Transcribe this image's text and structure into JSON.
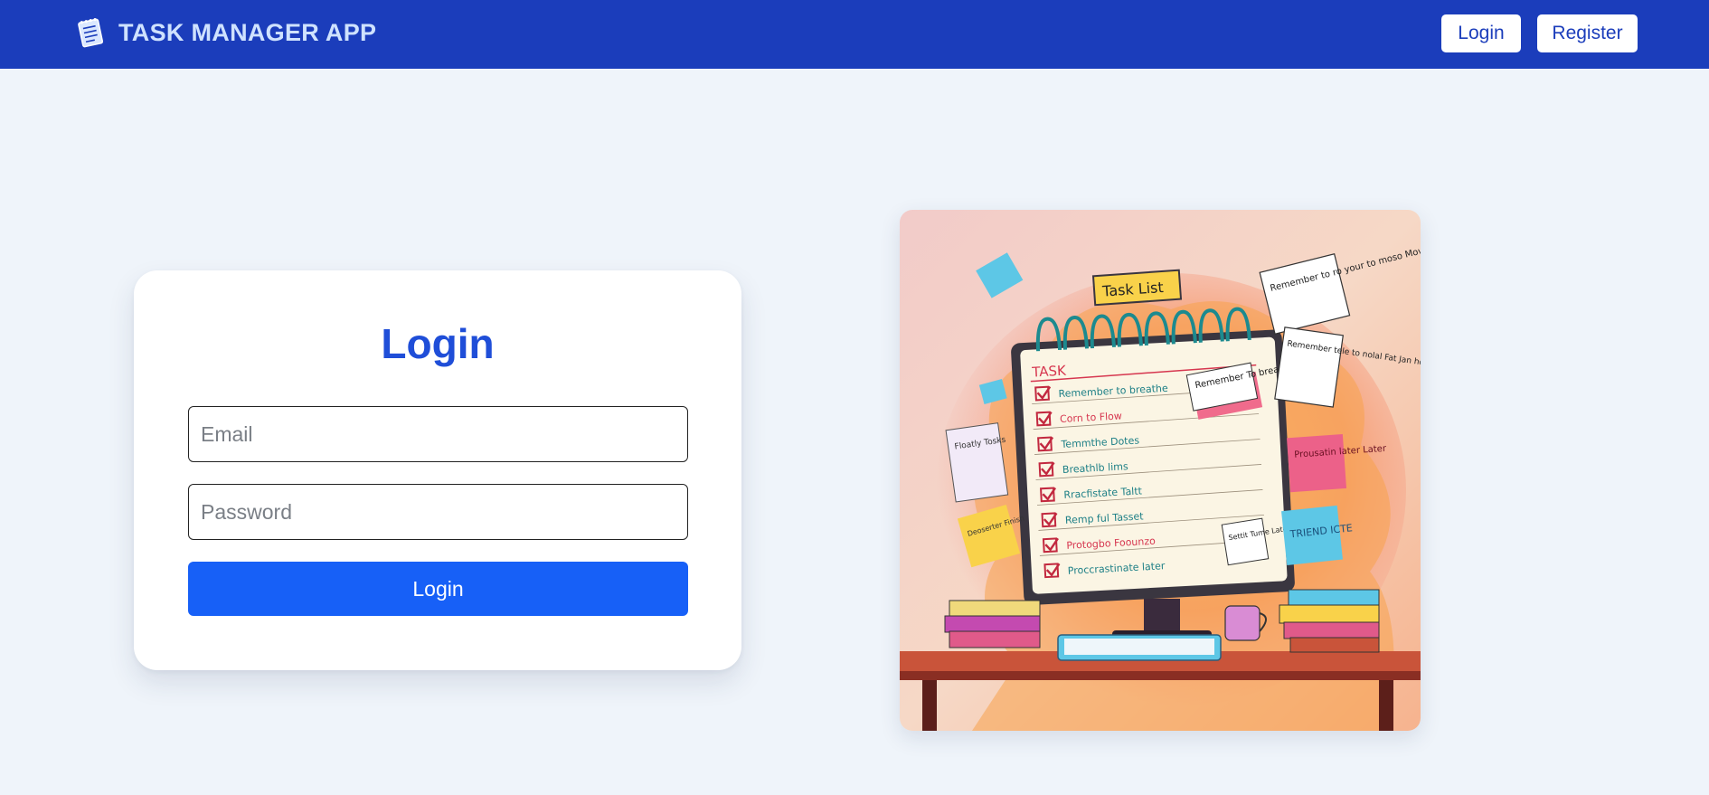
{
  "navbar": {
    "brand_title": "TASK MANAGER APP",
    "brand_icon": "notepad-icon",
    "login_label": "Login",
    "register_label": "Register",
    "background_color": "#1b3dbb"
  },
  "login_form": {
    "title": "Login",
    "email_placeholder": "Email",
    "password_placeholder": "Password",
    "submit_label": "Login",
    "accent_color": "#1760f7"
  },
  "illustration": {
    "banner": "Task List",
    "notebook_header": "TASK",
    "items": [
      "Remember to breathe",
      "Corn to Flow",
      "Temmthe Dotes",
      "Breathlb lims",
      "Rracfistate Taltt",
      "Remp ful Tasset",
      "Protogbo Foounzo",
      "Proccrastinate later"
    ],
    "notes": {
      "top_right": "Remember to ro your to moso Mow is",
      "right": "Remember tele to nolal Fat Jan ho Fer pay- Alors",
      "pink": "Prousatin later Later",
      "cyan": "TRIEND ICTE",
      "left": "Floatly Tosks",
      "yellow": "Deoserter Finish",
      "center": "Remember To breathe",
      "center_small": "Settit Tume Later"
    }
  }
}
